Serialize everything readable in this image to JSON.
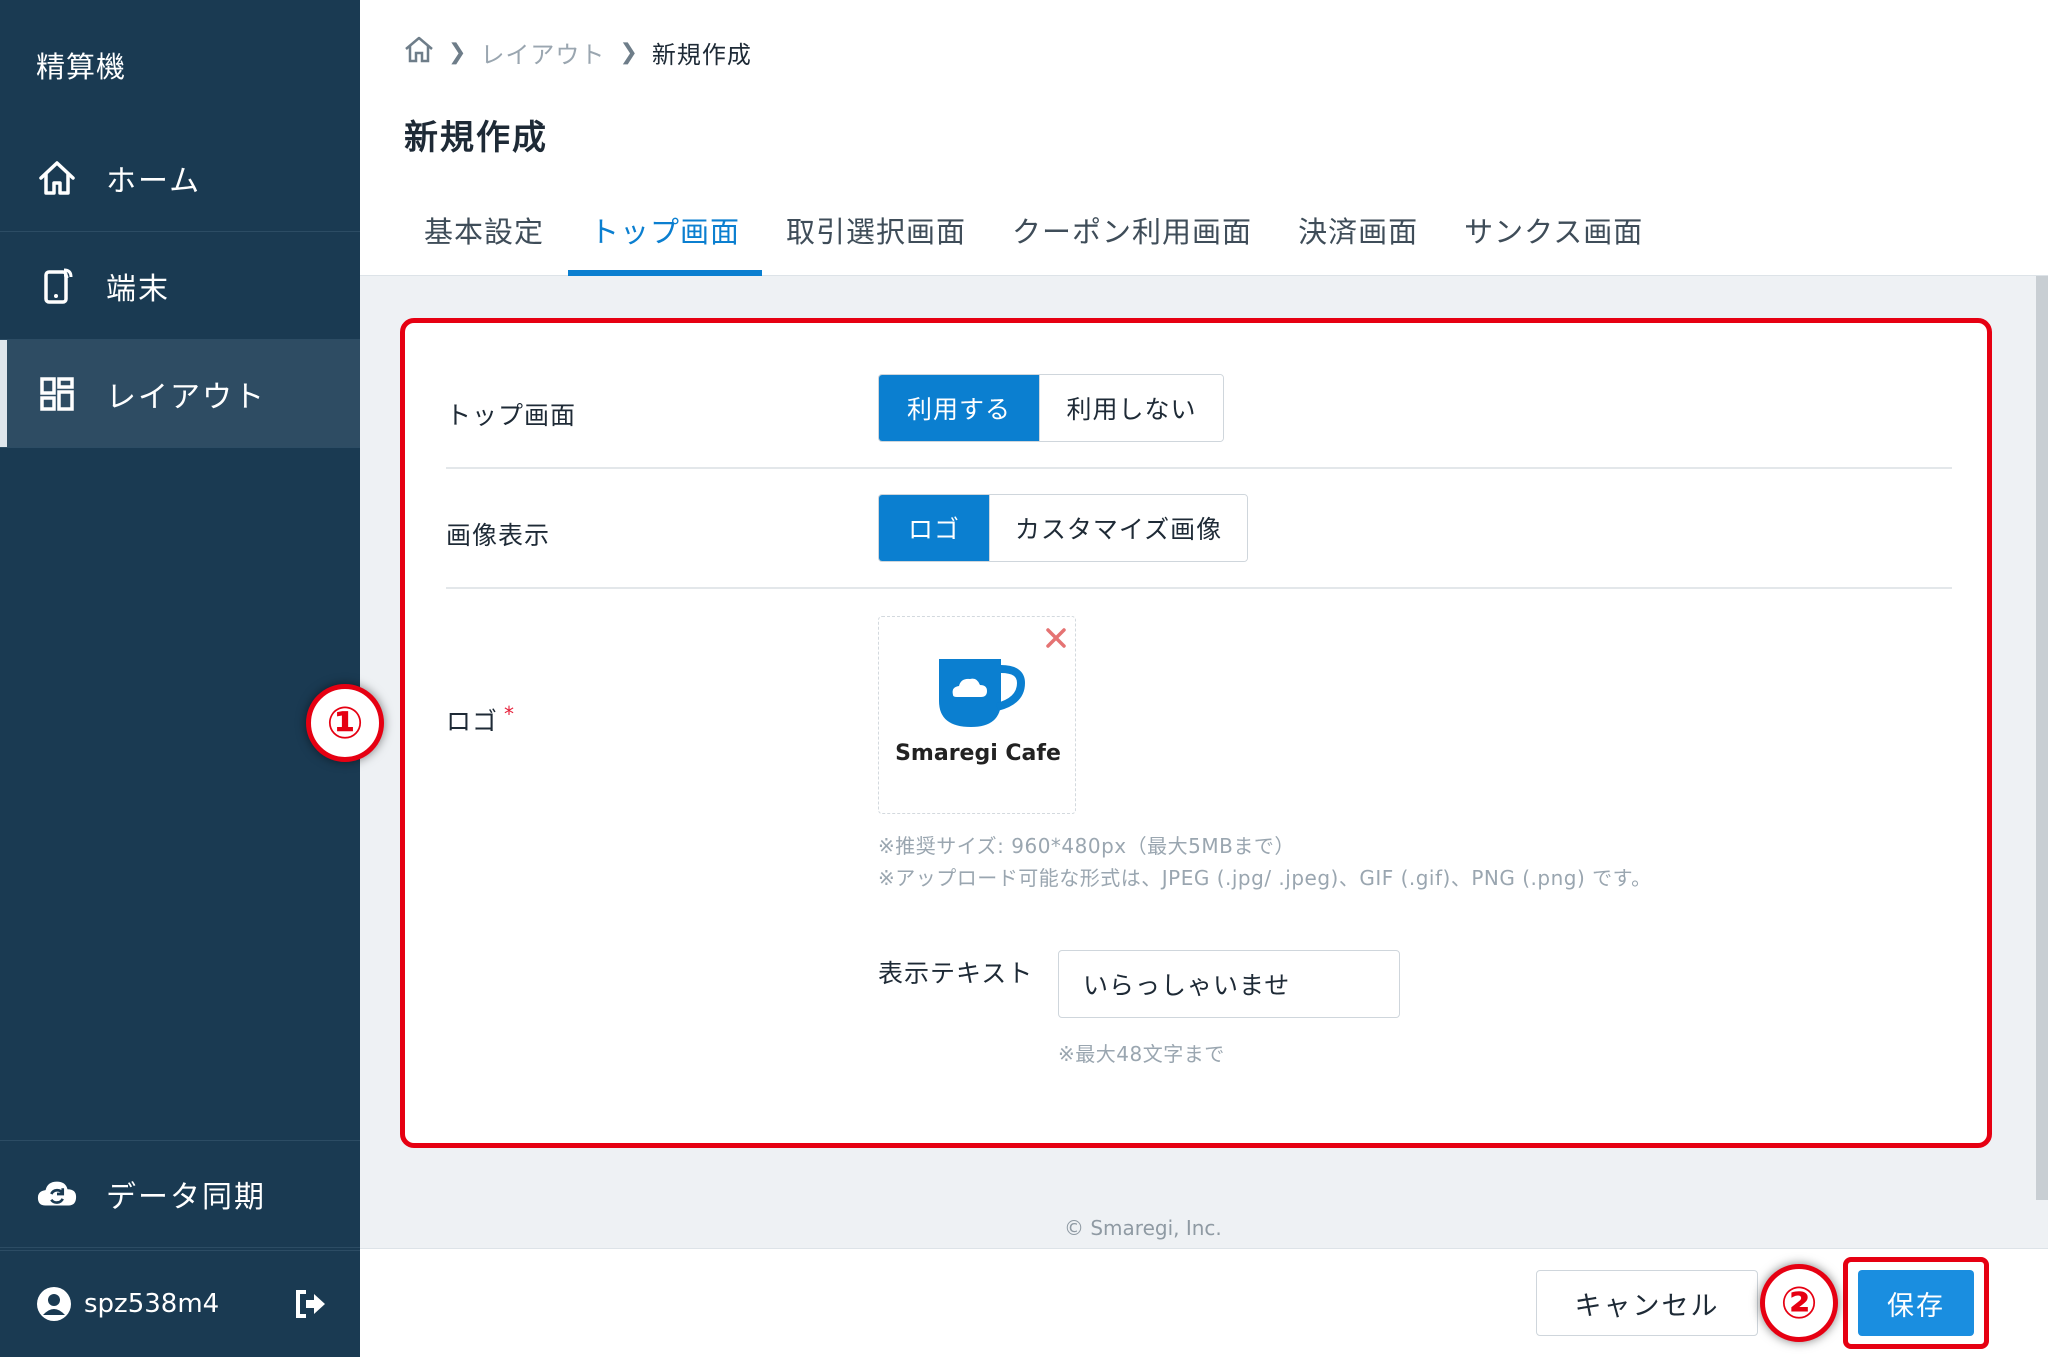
{
  "sidebar": {
    "app_title": "精算機",
    "items": [
      {
        "label": "ホーム",
        "icon": "home-icon"
      },
      {
        "label": "端末",
        "icon": "terminal-icon"
      },
      {
        "label": "レイアウト",
        "icon": "layout-icon",
        "active": true
      }
    ],
    "sync_label": "データ同期",
    "user_name": "spz538m4"
  },
  "header": {
    "breadcrumb": {
      "parent": "レイアウト",
      "current": "新規作成"
    },
    "title": "新規作成",
    "tabs": [
      "基本設定",
      "トップ画面",
      "取引選択画面",
      "クーポン利用画面",
      "決済画面",
      "サンクス画面"
    ],
    "active_tab": "トップ画面"
  },
  "form": {
    "top_screen": {
      "label": "トップ画面",
      "options": [
        "利用する",
        "利用しない"
      ],
      "selected": "利用する"
    },
    "image_display": {
      "label": "画像表示",
      "options": [
        "ロゴ",
        "カスタマイズ画像"
      ],
      "selected": "ロゴ"
    },
    "logo": {
      "label": "ロゴ",
      "required_mark": "*",
      "preview_text": "Smaregi Cafe",
      "hint_size": "※推奨サイズ: 960*480px（最大5MBまで）",
      "hint_format": "※アップロード可能な形式は、JPEG (.jpg/ .jpeg)、GIF (.gif)、PNG (.png) です。"
    },
    "display_text": {
      "label": "表示テキスト",
      "value": "いらっしゃいませ",
      "hint": "※最大48文字まで"
    }
  },
  "footer": {
    "copyright": "© Smaregi, Inc.",
    "cancel_label": "キャンセル",
    "save_label": "保存"
  },
  "annotations": {
    "badge_1": "①",
    "badge_2": "②"
  },
  "colors": {
    "sidebar_bg": "#1a3a52",
    "accent": "#0b7fd0",
    "highlight": "#e60012"
  }
}
